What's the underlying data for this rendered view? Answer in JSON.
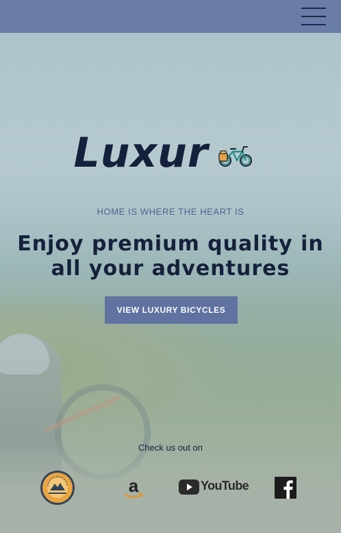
{
  "header": {
    "menu_icon": "hamburger-menu-icon"
  },
  "hero": {
    "brand": "Luxur",
    "brand_icon": "bicycle-icon",
    "tagline": "HOME IS WHERE THE HEART IS",
    "headline": "Enjoy premium quality in all your adventures",
    "cta_label": "VIEW LUXURY BICYCLES"
  },
  "partners": {
    "label": "Check us out on",
    "items": [
      {
        "name": "bearings-bike-shop",
        "icon": "bearings-bike-shop-logo-icon",
        "seal_text": "BEARINGS",
        "seal_subtext": "BIKE SHOP"
      },
      {
        "name": "amazon",
        "icon": "amazon-icon"
      },
      {
        "name": "youtube",
        "icon": "youtube-icon",
        "wordmark": "YouTube"
      },
      {
        "name": "facebook",
        "icon": "facebook-icon"
      }
    ]
  },
  "colors": {
    "header_bg": "#6a7da7",
    "brand_dark": "#15213c",
    "accent": "#5f72a0",
    "tagline": "#4f6391"
  }
}
